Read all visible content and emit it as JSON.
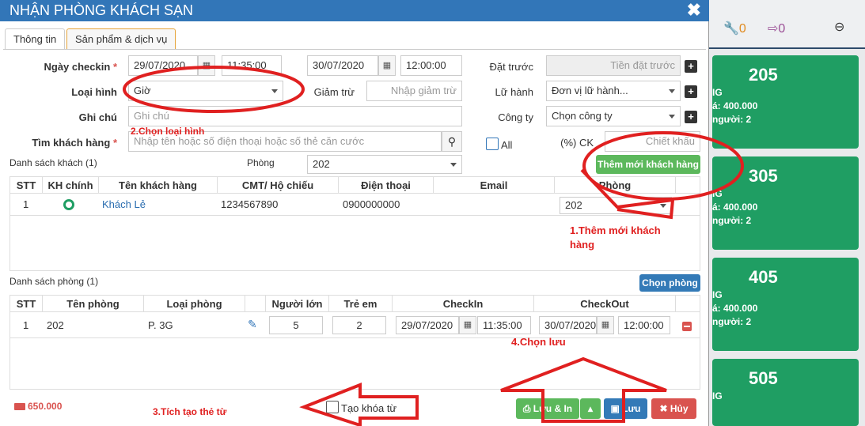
{
  "background": {
    "top_icons": [
      {
        "icon": "wrench-icon",
        "count": "0",
        "color": "#e08a1e"
      },
      {
        "icon": "sign-out-icon",
        "count": "0",
        "color": "#9b4f96"
      }
    ],
    "rooms": [
      {
        "number": "205",
        "line1": "IG",
        "line2": "á: 400.000",
        "line3": "người: 2"
      },
      {
        "number": "305",
        "line1": "IG",
        "line2": "á: 400.000",
        "line3": "người: 2"
      },
      {
        "number": "405",
        "line1": "IG",
        "line2": "á: 400.000",
        "line3": "người: 2"
      },
      {
        "number": "505",
        "line1": "IG",
        "line2": "",
        "line3": ""
      }
    ]
  },
  "modal": {
    "title": "NHẬN PHÒNG KHÁCH SẠN",
    "close": "✖",
    "tabs": [
      "Thông tin",
      "Sản phẩm & dịch vụ"
    ],
    "form": {
      "checkin_label": "Ngày checkin",
      "checkin_date": "29/07/2020",
      "checkin_time": "11:35:00",
      "checkout_date": "30/07/2020",
      "checkout_time": "12:00:00",
      "dat_truoc_label": "Đặt trước",
      "dat_truoc_placeholder": "Tiền đặt trước",
      "loai_hinh_label": "Loại hình",
      "loai_hinh_value": "Giờ",
      "giam_tru_label": "Giảm trừ",
      "giam_tru_placeholder": "Nhập giảm trừ",
      "lu_hanh_label": "Lữ hành",
      "lu_hanh_value": "Đơn vị lữ hành...",
      "ghi_chu_label": "Ghi chú",
      "ghi_chu_placeholder": "Ghi chú",
      "cong_ty_label": "Công ty",
      "cong_ty_value": "Chọn công ty",
      "tim_kh_label": "Tìm khách hàng",
      "tim_kh_placeholder": "Nhập tên hoặc số điện thoại hoặc số thẻ căn cước",
      "all_label": "All",
      "ck_label": "(%) CK",
      "ck_placeholder": "Chiết khấu"
    },
    "guests": {
      "section_label": "Danh sách khách (1)",
      "phong_label": "Phòng",
      "phong_value": "202",
      "add_button": "Thêm mới khách hàng",
      "headers": [
        "STT",
        "KH chính",
        "Tên khách hàng",
        "CMT/ Hộ chiếu",
        "Điện thoại",
        "Email",
        "Phòng"
      ],
      "rows": [
        {
          "stt": "1",
          "name": "Khách Lẻ",
          "id": "1234567890",
          "phone": "0900000000",
          "email": "",
          "room": "202"
        }
      ]
    },
    "rooms": {
      "section_label": "Danh sách phòng (1)",
      "choose_button": "Chọn phòng",
      "headers": [
        "STT",
        "Tên phòng",
        "Loại phòng",
        "Người lớn",
        "Trẻ em",
        "CheckIn",
        "CheckOut"
      ],
      "rows": [
        {
          "stt": "1",
          "name": "202",
          "type": "P. 3G",
          "adults": "5",
          "children": "2",
          "checkin_date": "29/07/2020",
          "checkin_time": "11:35:00",
          "checkout_date": "30/07/2020",
          "checkout_time": "12:00:00"
        }
      ]
    },
    "footer": {
      "total": "650.000",
      "tao_khoa_tu": "Tạo khóa từ",
      "save_print": "Lưu & In",
      "save": "Lưu",
      "cancel": "Hủy"
    }
  },
  "annotations": {
    "a1": "1.Thêm mới khách",
    "a1b": "hàng",
    "a2": "2.Chọn loại hình",
    "a3": "3.Tích tạo thẻ từ",
    "a4": "4.Chọn lưu",
    "color": "#e02020"
  }
}
